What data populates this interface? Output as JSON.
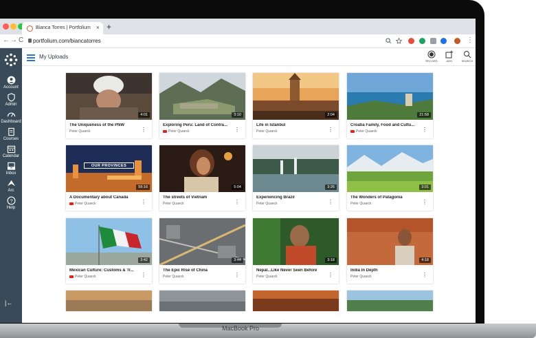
{
  "browser": {
    "tab_title": "Bianca Torres | Portfolium",
    "tab_close": "×",
    "new_tab": "+",
    "url": "portfolium.com/biancatorres"
  },
  "sidebar": {
    "items": [
      {
        "label": "Account",
        "icon": "user-icon"
      },
      {
        "label": "Admin",
        "icon": "shield-icon"
      },
      {
        "label": "Dashboard",
        "icon": "dashboard-icon"
      },
      {
        "label": "Courses",
        "icon": "book-icon"
      },
      {
        "label": "Calendar",
        "icon": "calendar-icon"
      },
      {
        "label": "Inbox",
        "icon": "inbox-icon"
      },
      {
        "label": "Arc",
        "icon": "arc-icon"
      },
      {
        "label": "Help",
        "icon": "help-icon"
      }
    ],
    "collapse": "|←"
  },
  "header": {
    "title": "My Uploads",
    "tools": [
      {
        "label": "RECORD",
        "icon": "record-icon"
      },
      {
        "label": "ADD",
        "icon": "add-icon"
      },
      {
        "label": "SEARCH",
        "icon": "search-icon"
      }
    ]
  },
  "videos": [
    {
      "title": "The Uniqueness of the PNW",
      "author": "Peter Quaeck",
      "duration": "4:01",
      "youtube": false
    },
    {
      "title": "Exploring Peru: Land of Contra...",
      "author": "Peter Quaeck",
      "duration": "3:10",
      "youtube": true
    },
    {
      "title": "Life in Istanbul",
      "author": "Peter Quaeck",
      "duration": "2:04",
      "youtube": false
    },
    {
      "title": "Croatia Family, Food and Cultu...",
      "author": "Peter Quaeck",
      "duration": "21:58",
      "youtube": true
    },
    {
      "title": "A Documentary about Canada",
      "author": "Peter Quaeck",
      "duration": "59:16",
      "youtube": true,
      "overlay": "OUR PROVINCES"
    },
    {
      "title": "The streets of Vietnam",
      "author": "Peter Quaeck",
      "duration": "5:04",
      "youtube": false
    },
    {
      "title": "Experiencing Brazil",
      "author": "Peter Quaeck",
      "duration": "3:26",
      "youtube": false
    },
    {
      "title": "The Wonders of Patagonia",
      "author": "Peter Quaeck",
      "duration": "3:01",
      "youtube": false
    },
    {
      "title": "Mexican Culture: Customs & Tr...",
      "author": "Peter Quaeck",
      "duration": "3:42",
      "youtube": true
    },
    {
      "title": "The Epic Rise of China",
      "author": "Peter Quaeck",
      "duration": "3:44",
      "youtube": false
    },
    {
      "title": "Nepal...Like Never Seen Before",
      "author": "Peter Quaeck",
      "duration": "3:18",
      "youtube": false
    },
    {
      "title": "India In Depth",
      "author": "Peter Quaeck",
      "duration": "4:18",
      "youtube": false
    }
  ],
  "kebab": "⋮",
  "laptop_brand": "MacBook Pro",
  "colors": {
    "sidebar": "#394b58",
    "accent": "#2d75c4",
    "youtube": "#e62117"
  }
}
